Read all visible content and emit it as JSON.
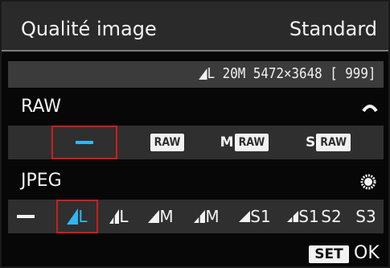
{
  "header": {
    "title": "Qualité image",
    "mode": "Standard"
  },
  "info": {
    "quality_icon": "large-fine-icon",
    "text": "L 20M 5472×3648 [ 999]"
  },
  "raw": {
    "label": "RAW",
    "dial_icon": "main-dial-icon",
    "options": [
      {
        "label": "—",
        "icon": "none-dash",
        "selected": true
      },
      {
        "label": "RAW",
        "prefix": "",
        "selected": false
      },
      {
        "label": "RAW",
        "prefix": "M",
        "selected": false
      },
      {
        "label": "RAW",
        "prefix": "S",
        "selected": false
      }
    ]
  },
  "jpeg": {
    "label": "JPEG",
    "dial_icon": "quick-control-dial-icon",
    "options": [
      {
        "label": "—",
        "icon": "none-dash",
        "selected": false
      },
      {
        "label": "L",
        "icon": "fine-icon",
        "selected": true
      },
      {
        "label": "L",
        "icon": "normal-icon",
        "selected": false
      },
      {
        "label": "M",
        "icon": "fine-icon",
        "selected": false
      },
      {
        "label": "M",
        "icon": "normal-icon",
        "selected": false
      },
      {
        "label": "S1",
        "icon": "fine-icon",
        "selected": false
      },
      {
        "label": "S1",
        "icon": "normal-icon",
        "selected": false
      },
      {
        "label": "S2",
        "icon": "",
        "selected": false
      },
      {
        "label": "S3",
        "icon": "",
        "selected": false
      }
    ]
  },
  "footer": {
    "set_label": "SET",
    "ok_label": "OK"
  },
  "colors": {
    "accent": "#2fb7f0",
    "selection": "#d01c1c",
    "header_bg": "#2a2a2a",
    "row_bg": "#2f2f2f"
  }
}
